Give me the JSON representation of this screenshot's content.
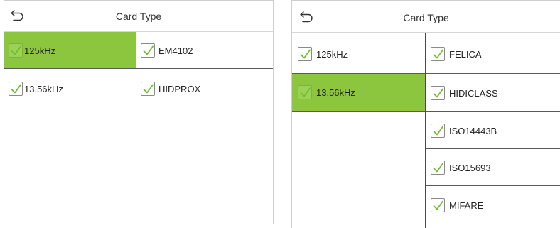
{
  "left_screen": {
    "title": "Card Type",
    "frequencies": [
      {
        "label": "125kHz",
        "selected": true
      },
      {
        "label": "13.56kHz",
        "selected": false
      }
    ],
    "card_types": [
      {
        "label": "EM4102",
        "checked": true
      },
      {
        "label": "HIDPROX",
        "checked": true
      }
    ]
  },
  "right_screen": {
    "title": "Card Type",
    "frequencies": [
      {
        "label": "125kHz",
        "selected": false
      },
      {
        "label": "13.56kHz",
        "selected": true
      }
    ],
    "card_types": [
      {
        "label": "FELICA",
        "checked": true
      },
      {
        "label": "HIDICLASS",
        "checked": true
      },
      {
        "label": "ISO14443B",
        "checked": true
      },
      {
        "label": "ISO15693",
        "checked": true
      },
      {
        "label": "MIFARE",
        "checked": true
      }
    ]
  },
  "colors": {
    "selected_row": "#8cc63f",
    "check_mark": "#6fbf2a"
  },
  "icons": {
    "back": "return-arrow-icon",
    "checkbox": "checkmark-icon"
  }
}
